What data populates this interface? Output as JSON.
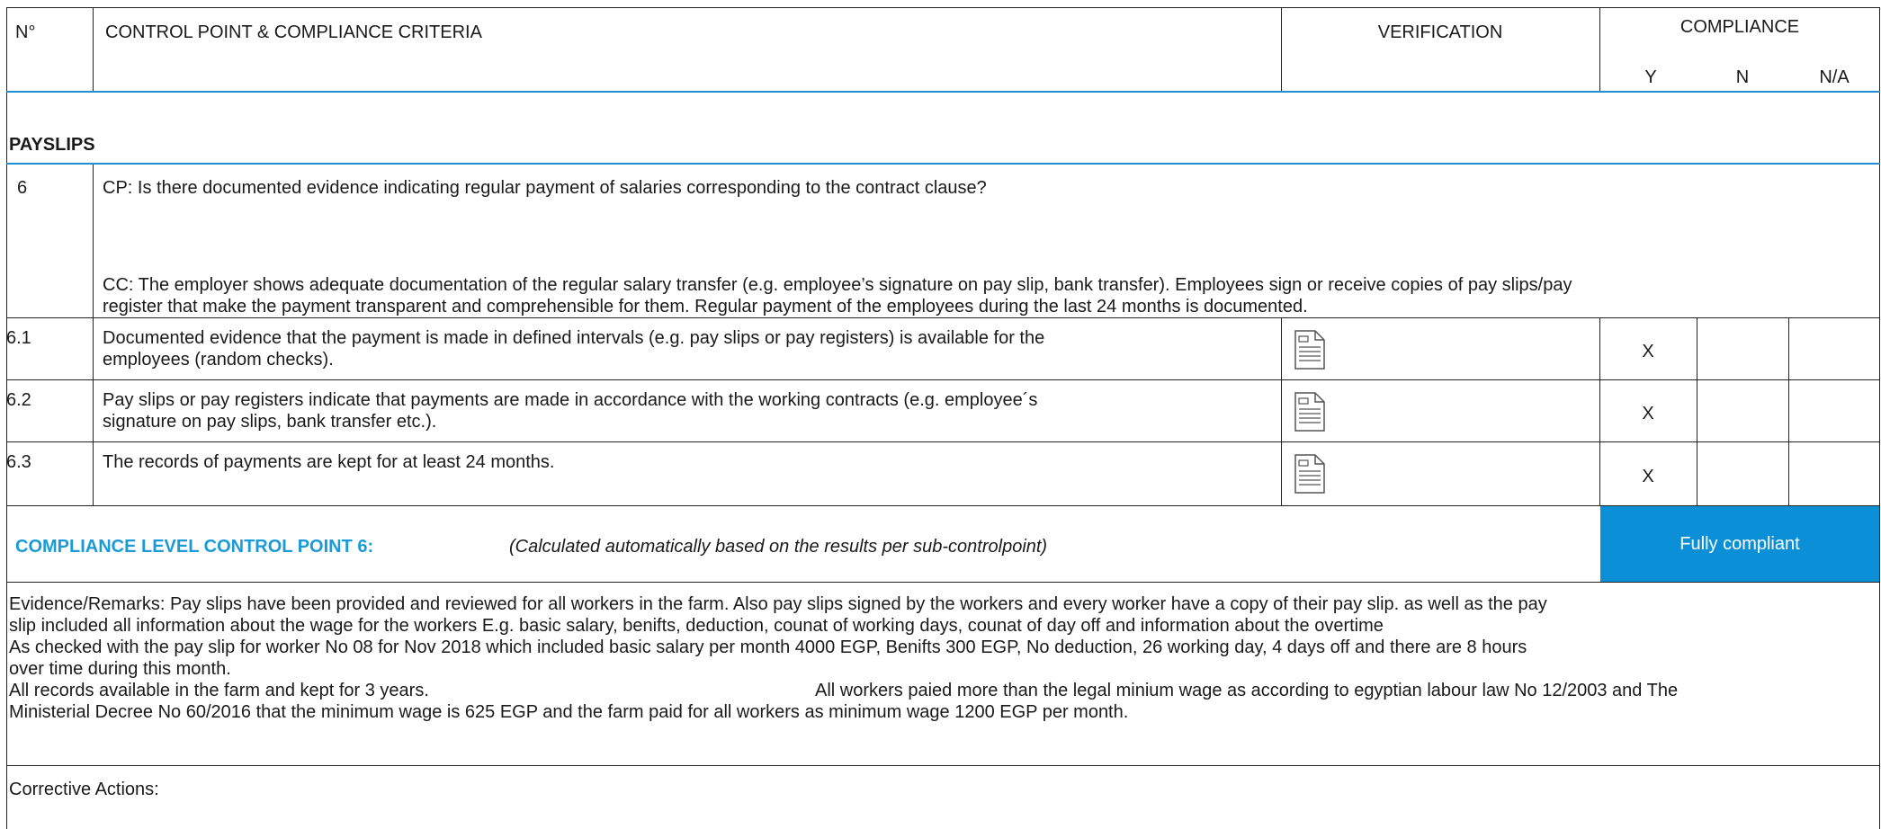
{
  "header": {
    "number": "N°",
    "control_point": "CONTROL POINT & COMPLIANCE CRITERIA",
    "verification": "VERIFICATION",
    "compliance": "COMPLIANCE",
    "y": "Y",
    "n": "N",
    "na": "N/A"
  },
  "section": {
    "title": "PAYSLIPS"
  },
  "control_point": {
    "number": "6",
    "cp": "CP: Is there documented evidence indicating regular payment of salaries corresponding to the contract clause?",
    "cc_line1": "CC: The employer shows adequate documentation of the regular salary transfer (e.g. employee’s signature on pay slip, bank transfer). Employees sign or receive copies of pay slips/pay",
    "cc_line2": "register that make the payment transparent and comprehensible for them. Regular payment of the employees during the last 24 months is documented."
  },
  "rows": [
    {
      "number": "6.1",
      "line1": "Documented evidence that the payment is made in defined intervals (e.g. pay slips or pay registers) is available for the",
      "line2": "employees (random checks).",
      "icon": "document-icon",
      "y": "X",
      "n": "",
      "na": ""
    },
    {
      "number": "6.2",
      "line1": "Pay slips or pay registers indicate that payments are made in accordance with the working contracts (e.g. employee´s",
      "line2": "signature on pay slips, bank transfer etc.).",
      "icon": "document-icon",
      "y": "X",
      "n": "",
      "na": ""
    },
    {
      "number": "6.3",
      "line1": "The records of payments are kept for at least 24 months.",
      "line2": "",
      "icon": "document-icon",
      "y": "X",
      "n": "",
      "na": ""
    }
  ],
  "compliance_level": {
    "label": "COMPLIANCE LEVEL CONTROL POINT 6:",
    "note": "(Calculated automatically based on the results per sub-controlpoint)",
    "result": "Fully compliant",
    "result_color": "#0b8fd6",
    "label_color": "#1a9bd7"
  },
  "evidence": {
    "line1": "Evidence/Remarks: Pay slips have been provided and reviewed for all workers in the farm. Also pay slips signed by the workers and every worker have a copy of their pay slip. as well as the pay",
    "line2": "slip included all information about the wage for the workers E.g. basic salary, benifts, deduction, counat of working days, counat of day off and information about the overtime",
    "line3": "As checked with the pay slip for worker No 08   for  Nov 2018 which included basic salary per month 4000 EGP, Benifts 300 EGP, No deduction, 26 working day, 4 days off and there are 8 hours",
    "line4": "over time during this month.",
    "line5a": "All records available in the farm and kept for 3 years.",
    "line5b": "All workers paied more than the legal minium wage as according to egyptian labour law No 12/2003 and The",
    "line6": "Ministerial Decree No 60/2016 that the minimum wage is 625  EGP and the farm paid for all workers as minimum wage 1200 EGP per month."
  },
  "corrective": {
    "label": "Corrective Actions:"
  }
}
